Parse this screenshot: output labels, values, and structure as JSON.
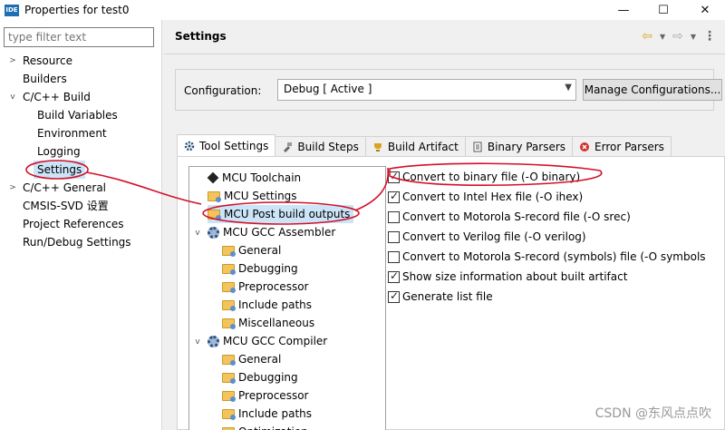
{
  "window": {
    "icon_text": "IDE",
    "title": "Properties for test0",
    "minimize": "—",
    "maximize": "☐",
    "close": "✕"
  },
  "left": {
    "filter_placeholder": "type filter text",
    "items": [
      {
        "label": "Resource"
      },
      {
        "label": "Builders"
      },
      {
        "label": "C/C++ Build"
      },
      {
        "label": "Build Variables"
      },
      {
        "label": "Environment"
      },
      {
        "label": "Logging"
      },
      {
        "label": "Settings"
      },
      {
        "label": "C/C++ General"
      },
      {
        "label": "CMSIS-SVD 设置"
      },
      {
        "label": "Project References"
      },
      {
        "label": "Run/Debug Settings"
      }
    ]
  },
  "header": {
    "title": "Settings"
  },
  "config": {
    "label": "Configuration:",
    "value": "Debug  [ Active ]",
    "manage_label": "Manage Configurations..."
  },
  "tabs": [
    {
      "label": "Tool Settings"
    },
    {
      "label": "Build Steps"
    },
    {
      "label": "Build Artifact"
    },
    {
      "label": "Binary Parsers"
    },
    {
      "label": "Error Parsers"
    }
  ],
  "tool_tree": [
    {
      "label": "MCU Toolchain"
    },
    {
      "label": "MCU Settings"
    },
    {
      "label": "MCU Post build outputs"
    },
    {
      "label": "MCU GCC Assembler"
    },
    {
      "label": "General"
    },
    {
      "label": "Debugging"
    },
    {
      "label": "Preprocessor"
    },
    {
      "label": "Include paths"
    },
    {
      "label": "Miscellaneous"
    },
    {
      "label": "MCU GCC Compiler"
    },
    {
      "label": "General"
    },
    {
      "label": "Debugging"
    },
    {
      "label": "Preprocessor"
    },
    {
      "label": "Include paths"
    },
    {
      "label": "Optimization"
    }
  ],
  "options": [
    {
      "label": "Convert to binary file (-O binary)",
      "checked": true
    },
    {
      "label": "Convert to Intel Hex file (-O ihex)",
      "checked": true
    },
    {
      "label": "Convert to Motorola S-record file (-O srec)",
      "checked": false
    },
    {
      "label": "Convert to Verilog file (-O verilog)",
      "checked": false
    },
    {
      "label": "Convert to Motorola S-record (symbols) file (-O symbols",
      "checked": false
    },
    {
      "label": "Show size information about built artifact",
      "checked": true
    },
    {
      "label": "Generate list file",
      "checked": true
    }
  ],
  "watermark": "CSDN @东风点点吹",
  "colors": {
    "annotation": "#d3102a",
    "selection": "#cce4f7"
  }
}
